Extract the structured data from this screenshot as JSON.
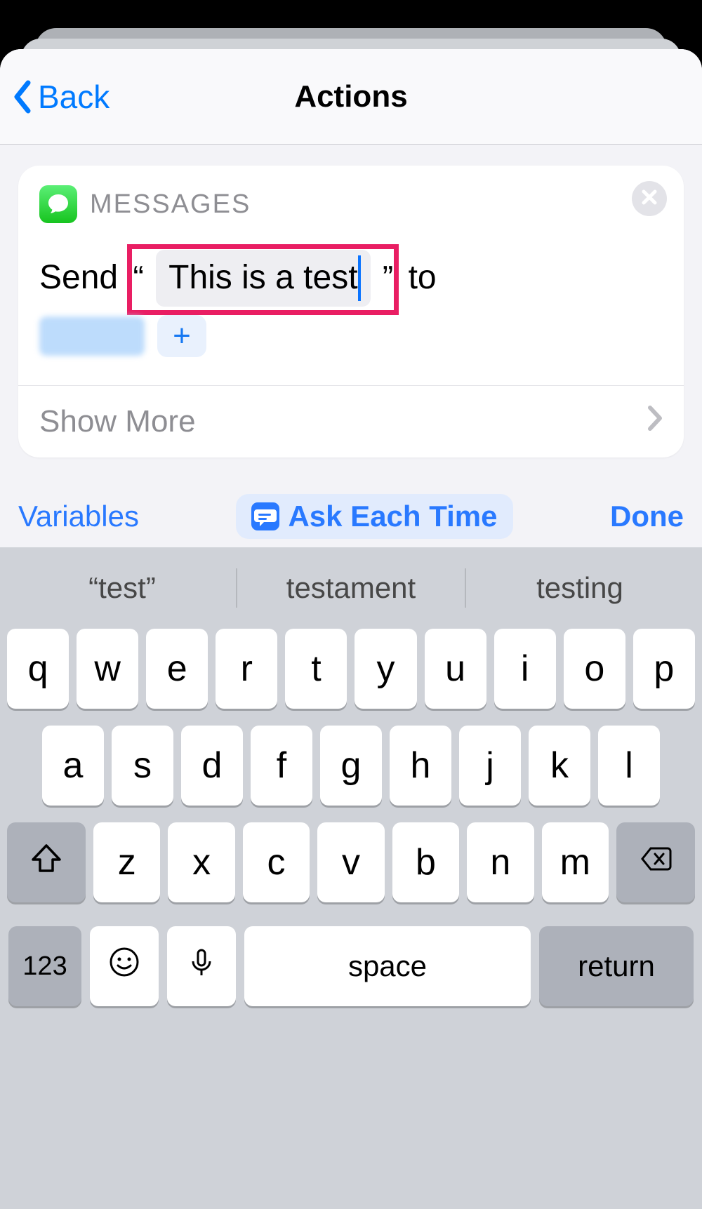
{
  "header": {
    "back_label": "Back",
    "title": "Actions"
  },
  "card": {
    "app_name": "MESSAGES",
    "send_prefix": "Send",
    "open_quote": "“",
    "message_text": "This is a test",
    "close_quote": "”",
    "send_suffix": "to",
    "add_recipient_glyph": "+",
    "show_more_label": "Show More"
  },
  "toolbar": {
    "variables_label": "Variables",
    "ask_each_time_label": "Ask Each Time",
    "done_label": "Done"
  },
  "keyboard": {
    "suggestions": [
      "“test”",
      "testament",
      "testing"
    ],
    "row1": [
      "q",
      "w",
      "e",
      "r",
      "t",
      "y",
      "u",
      "i",
      "o",
      "p"
    ],
    "row2": [
      "a",
      "s",
      "d",
      "f",
      "g",
      "h",
      "j",
      "k",
      "l"
    ],
    "row3": [
      "z",
      "x",
      "c",
      "v",
      "b",
      "n",
      "m"
    ],
    "key_123": "123",
    "key_space": "space",
    "key_return": "return"
  }
}
